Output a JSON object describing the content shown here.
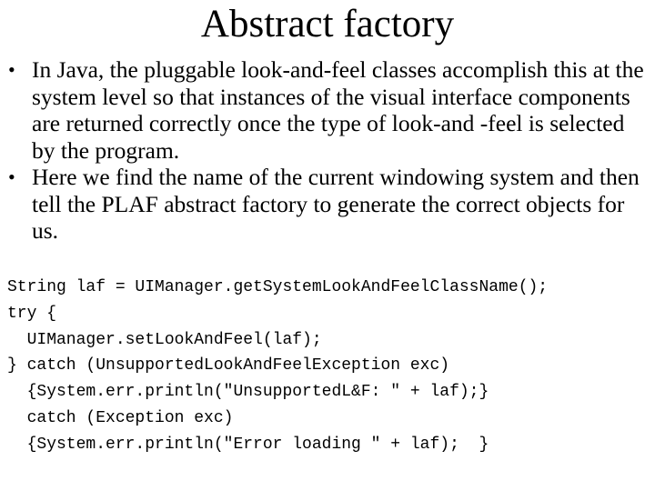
{
  "slide": {
    "title": "Abstract factory",
    "bullets": [
      {
        "marker": "•",
        "text": "In Java, the pluggable look-and-feel classes accomplish this at the system level so that instances of the visual interface components are returned correctly once the type of look-and -feel is selected by the program."
      },
      {
        "marker": "•",
        "text": "Here we find the name of the current windowing system and then tell the PLAF abstract factory to generate the correct objects for us."
      }
    ],
    "code_lines": [
      "String laf = UIManager.getSystemLookAndFeelClassName();",
      "try {",
      "  UIManager.setLookAndFeel(laf);",
      "} catch (UnsupportedLookAndFeelException exc)",
      "  {System.err.println(\"UnsupportedL&F: \" + laf);}",
      "  catch (Exception exc)",
      "  {System.err.println(\"Error loading \" + laf);  }"
    ]
  }
}
